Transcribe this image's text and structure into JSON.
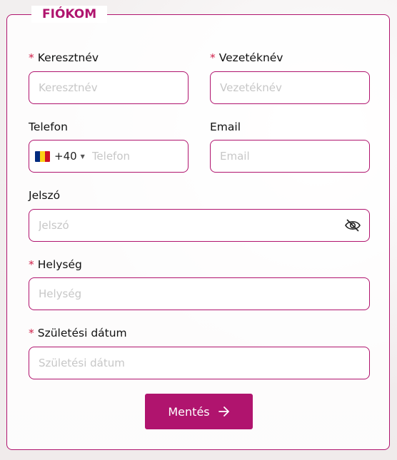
{
  "section": {
    "title": "FIÓKOM"
  },
  "fields": {
    "first_name": {
      "label": "Keresztnév",
      "required": true,
      "placeholder": "Keresztnév",
      "value": ""
    },
    "last_name": {
      "label": "Vezetéknév",
      "required": true,
      "placeholder": "Vezetéknév",
      "value": ""
    },
    "phone": {
      "label": "Telefon",
      "required": false,
      "dial_code": "+40",
      "placeholder": "Telefon",
      "value": "",
      "flag_icon": "romania-flag-icon"
    },
    "email": {
      "label": "Email",
      "required": false,
      "placeholder": "Email",
      "value": ""
    },
    "password": {
      "label": "Jelszó",
      "required": false,
      "placeholder": "Jelszó",
      "value": "",
      "toggle_icon": "eye-slash-icon"
    },
    "city": {
      "label": "Helység",
      "required": true,
      "placeholder": "Helység",
      "value": ""
    },
    "birth_date": {
      "label": "Születési dátum",
      "required": true,
      "placeholder": "Születési dátum",
      "value": ""
    }
  },
  "required_marker": "*",
  "save_button": {
    "label": "Mentés",
    "icon": "arrow-right-icon"
  },
  "colors": {
    "accent": "#b0146e",
    "required": "#d0204a",
    "flag": [
      "#002b7f",
      "#fcd116",
      "#ce1126"
    ]
  }
}
